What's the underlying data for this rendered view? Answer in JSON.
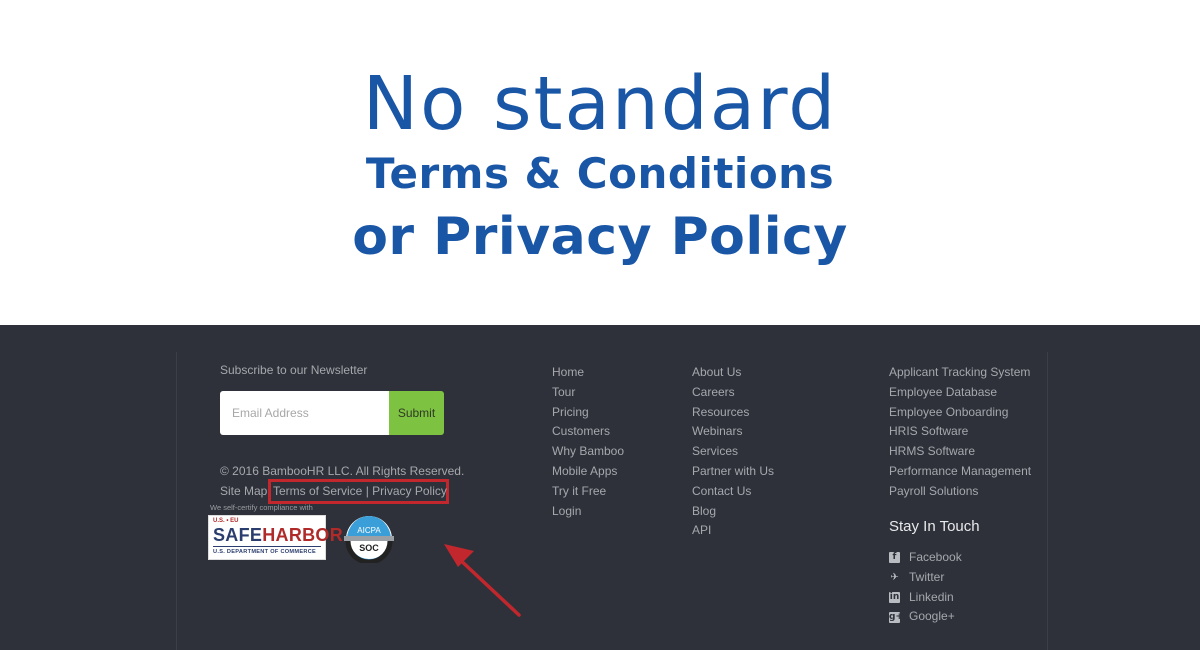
{
  "hero": {
    "line1": "No standard",
    "line2": "Terms & Conditions",
    "line3": "or Privacy Policy",
    "color": "#1a56a6"
  },
  "footer": {
    "newsletter": {
      "label": "Subscribe to our Newsletter",
      "email_placeholder": "Email Address",
      "email_value": "",
      "submit_label": "Submit"
    },
    "copyright": "© 2016 BambooHR LLC. All Rights Reserved.",
    "legal": {
      "site_map": "Site Map",
      "terms": "Terms of Service",
      "separator": "|",
      "privacy": "Privacy Policy"
    },
    "certifications": {
      "note": "We self-certify compliance with",
      "safeharbor": {
        "top": "U.S. • EU",
        "safe": "SAFE",
        "harbor": "HARBOR",
        "bottom": "U.S. DEPARTMENT OF COMMERCE"
      },
      "aicpa": {
        "top": "AICPA",
        "bottom": "SOC"
      }
    },
    "columns": [
      {
        "links": [
          "Home",
          "Tour",
          "Pricing",
          "Customers",
          "Why Bamboo",
          "Mobile Apps",
          "Try it Free",
          "Login"
        ]
      },
      {
        "links": [
          "About Us",
          "Careers",
          "Resources",
          "Webinars",
          "Services",
          "Partner with Us",
          "Contact Us",
          "Blog",
          "API"
        ]
      },
      {
        "links": [
          "Applicant Tracking System",
          "Employee Database",
          "Employee Onboarding",
          "HRIS Software",
          "HRMS Software",
          "Performance Management",
          "Payroll Solutions"
        ]
      }
    ],
    "stay_in_touch": {
      "title": "Stay In Touch",
      "social": [
        {
          "label": "Facebook",
          "icon": "facebook-icon",
          "glyph": "f"
        },
        {
          "label": "Twitter",
          "icon": "twitter-icon",
          "glyph": "🐦"
        },
        {
          "label": "Linkedin",
          "icon": "linkedin-icon",
          "glyph": "in"
        },
        {
          "label": "Google+",
          "icon": "google-plus-icon",
          "glyph": "g+"
        }
      ]
    },
    "highlight_color": "#c1272d",
    "submit_color": "#7ec242"
  }
}
